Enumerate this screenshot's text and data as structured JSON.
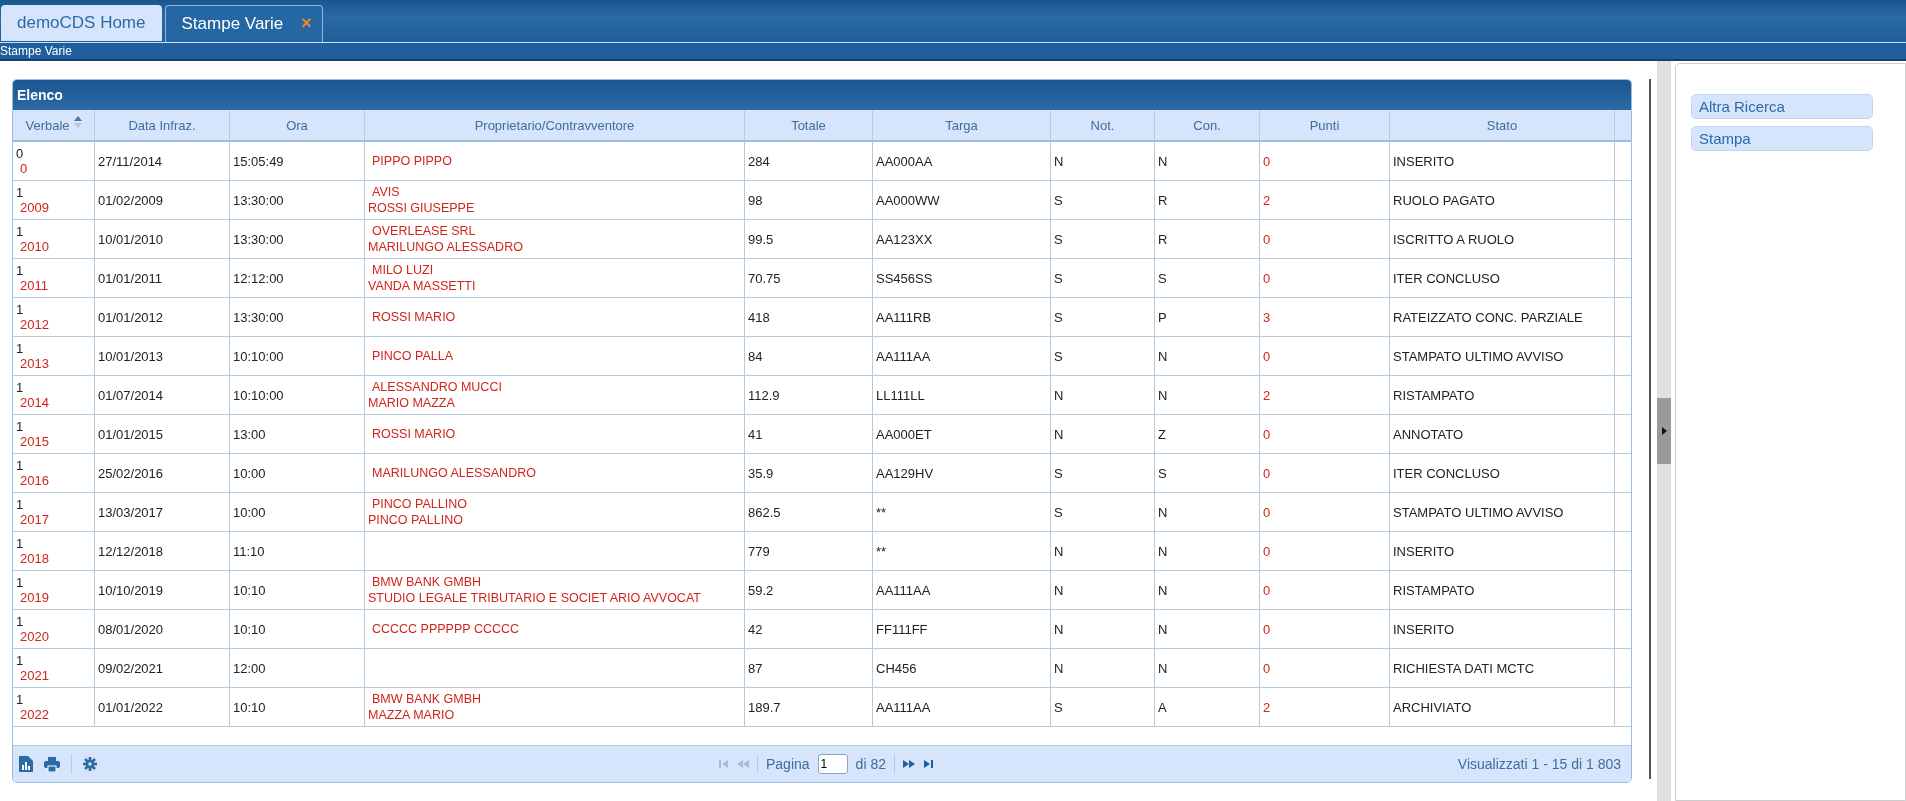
{
  "tabs": [
    {
      "label": "demoCDS Home",
      "selected": false
    },
    {
      "label": "Stampe Varie",
      "selected": true,
      "close": "×"
    }
  ],
  "breadcrumb": "Stampe Varie",
  "grid": {
    "title": "Elenco",
    "columns": [
      {
        "label": "Verbale",
        "sorted": true
      },
      {
        "label": "Data Infraz.",
        "sorted": false
      },
      {
        "label": "Ora",
        "sorted": false
      },
      {
        "label": "Proprietario/Contravventore",
        "sorted": false
      },
      {
        "label": "Totale",
        "sorted": false
      },
      {
        "label": "Targa",
        "sorted": false
      },
      {
        "label": "Not.",
        "sorted": false
      },
      {
        "label": "Con.",
        "sorted": false
      },
      {
        "label": "Punti",
        "sorted": false
      },
      {
        "label": "Stato",
        "sorted": false
      }
    ],
    "rows": [
      {
        "verbale": "0",
        "anno": "0",
        "data": "27/11/2014",
        "ora": "15:05:49",
        "owners": [
          "PIPPO PIPPO"
        ],
        "totale": "284",
        "targa": "AA000AA",
        "not": "N",
        "con": "N",
        "punti": "0",
        "stato": "INSERITO"
      },
      {
        "verbale": "1",
        "anno": "2009",
        "data": "01/02/2009",
        "ora": "13:30:00",
        "owners": [
          "AVIS",
          "ROSSI GIUSEPPE"
        ],
        "totale": "98",
        "targa": "AA000WW",
        "not": "S",
        "con": "R",
        "punti": "2",
        "stato": "RUOLO PAGATO"
      },
      {
        "verbale": "1",
        "anno": "2010",
        "data": "10/01/2010",
        "ora": "13:30:00",
        "owners": [
          "OVERLEASE SRL",
          "MARILUNGO ALESSADRO"
        ],
        "totale": "99.5",
        "targa": "AA123XX",
        "not": "S",
        "con": "R",
        "punti": "0",
        "stato": "ISCRITTO A RUOLO"
      },
      {
        "verbale": "1",
        "anno": "2011",
        "data": "01/01/2011",
        "ora": "12:12:00",
        "owners": [
          "MILO LUZI",
          "VANDA MASSETTI"
        ],
        "totale": "70.75",
        "targa": "SS456SS",
        "not": "S",
        "con": "S",
        "punti": "0",
        "stato": "ITER CONCLUSO"
      },
      {
        "verbale": "1",
        "anno": "2012",
        "data": "01/01/2012",
        "ora": "13:30:00",
        "owners": [
          "ROSSI MARIO"
        ],
        "totale": "418",
        "targa": "AA111RB",
        "not": "S",
        "con": "P",
        "punti": "3",
        "stato": "RATEIZZATO CONC. PARZIALE"
      },
      {
        "verbale": "1",
        "anno": "2013",
        "data": "10/01/2013",
        "ora": "10:10:00",
        "owners": [
          "PINCO PALLA"
        ],
        "totale": "84",
        "targa": "AA111AA",
        "not": "S",
        "con": "N",
        "punti": "0",
        "stato": "STAMPATO ULTIMO AVVISO"
      },
      {
        "verbale": "1",
        "anno": "2014",
        "data": "01/07/2014",
        "ora": "10:10:00",
        "owners": [
          "ALESSANDRO MUCCI",
          "MARIO MAZZA"
        ],
        "totale": "112.9",
        "targa": "LL111LL",
        "not": "N",
        "con": "N",
        "punti": "2",
        "stato": "RISTAMPATO"
      },
      {
        "verbale": "1",
        "anno": "2015",
        "data": "01/01/2015",
        "ora": "13:00",
        "owners": [
          "ROSSI MARIO"
        ],
        "totale": "41",
        "targa": "AA000ET",
        "not": "N",
        "con": "Z",
        "punti": "0",
        "stato": "ANNOTATO"
      },
      {
        "verbale": "1",
        "anno": "2016",
        "data": "25/02/2016",
        "ora": "10:00",
        "owners": [
          "MARILUNGO ALESSANDRO"
        ],
        "totale": "35.9",
        "targa": "AA129HV",
        "not": "S",
        "con": "S",
        "punti": "0",
        "stato": "ITER CONCLUSO"
      },
      {
        "verbale": "1",
        "anno": "2017",
        "data": "13/03/2017",
        "ora": "10:00",
        "owners": [
          "PINCO PALLINO",
          "PINCO PALLINO"
        ],
        "totale": "862.5",
        "targa": "**",
        "not": "S",
        "con": "N",
        "punti": "0",
        "stato": "STAMPATO ULTIMO AVVISO"
      },
      {
        "verbale": "1",
        "anno": "2018",
        "data": "12/12/2018",
        "ora": "11:10",
        "owners": [],
        "totale": "779",
        "targa": "**",
        "not": "N",
        "con": "N",
        "punti": "0",
        "stato": "INSERITO"
      },
      {
        "verbale": "1",
        "anno": "2019",
        "data": "10/10/2019",
        "ora": "10:10",
        "owners": [
          "BMW BANK GMBH",
          "STUDIO LEGALE TRIBUTARIO E SOCIET ARIO AVVOCAT"
        ],
        "totale": "59.2",
        "targa": "AA111AA",
        "not": "N",
        "con": "N",
        "punti": "0",
        "stato": "RISTAMPATO"
      },
      {
        "verbale": "1",
        "anno": "2020",
        "data": "08/01/2020",
        "ora": "10:10",
        "owners": [
          "CCCCC PPPPPP CCCCC"
        ],
        "totale": "42",
        "targa": "FF111FF",
        "not": "N",
        "con": "N",
        "punti": "0",
        "stato": "INSERITO"
      },
      {
        "verbale": "1",
        "anno": "2021",
        "data": "09/02/2021",
        "ora": "12:00",
        "owners": [],
        "totale": "87",
        "targa": "CH456",
        "not": "N",
        "con": "N",
        "punti": "0",
        "stato": "RICHIESTA DATI MCTC"
      },
      {
        "verbale": "1",
        "anno": "2022",
        "data": "01/01/2022",
        "ora": "10:10",
        "owners": [
          "BMW BANK GMBH",
          "MAZZA MARIO"
        ],
        "totale": "189.7",
        "targa": "AA111AA",
        "not": "S",
        "con": "A",
        "punti": "2",
        "stato": "ARCHIVIATO"
      }
    ],
    "pager": {
      "page_label": "Pagina",
      "page": "1",
      "of": "di 82",
      "summary": "Visualizzati 1 - 15 di 1 803"
    }
  },
  "actions": [
    "Altra Ricerca",
    "Stampa"
  ]
}
